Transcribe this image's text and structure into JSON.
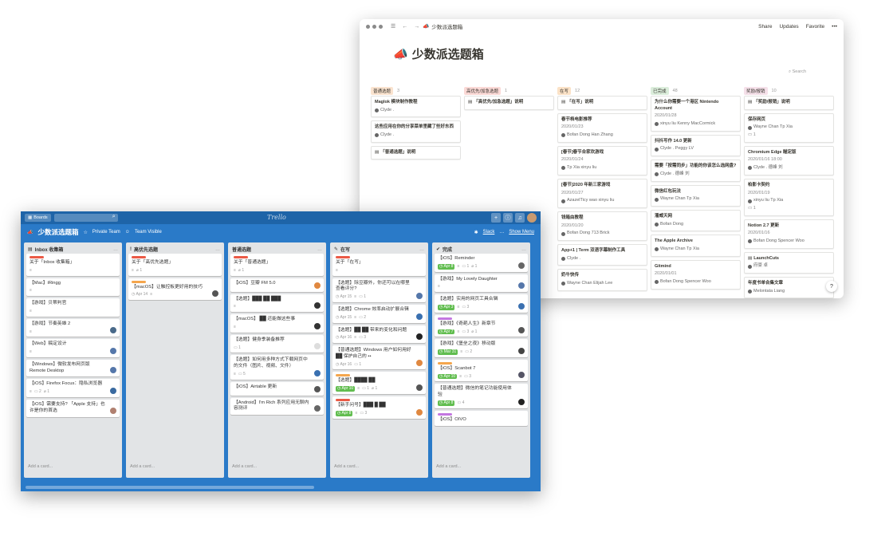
{
  "notion": {
    "breadcrumb": "少数派选题箱",
    "actions": [
      "Share",
      "Updates",
      "Favorite",
      "•••"
    ],
    "title": "少数派选题箱",
    "title_icon": "megaphone-icon",
    "search_label": "Search",
    "columns": [
      {
        "tag": "普通选题",
        "count": "3",
        "color": "#fae3cf",
        "cards": [
          {
            "title": "Maglok 模块制作教程",
            "people": "Clyde ."
          },
          {
            "title": "这些应用在你的分享菜单里藏了些好东西",
            "people": "Clyde ."
          },
          {
            "title": "「普通选题」说明",
            "doc": true
          }
        ]
      },
      {
        "tag": "高优先/加急选题",
        "count": "1",
        "color": "#fbd9d6",
        "cards": [
          {
            "title": "「高优先/加急选题」说明",
            "doc": true
          }
        ]
      },
      {
        "tag": "在写",
        "count": "12",
        "color": "#fbe2c7",
        "cards": [
          {
            "title": "「在写」说明",
            "doc": true
          },
          {
            "title": "春节档电影推荐",
            "date": "2020/01/23",
            "people": "Bofan Dong  Han Zhang"
          },
          {
            "title": "[春节]春节合家欢游戏",
            "date": "2020/01/24",
            "people": "Tp Xia  xinyu liu"
          },
          {
            "title": "[春节]2020 年新三家游戏",
            "date": "2020/01/27",
            "people": "AzazelTicy wao  xinyu liu"
          },
          {
            "title": "钱箱由教程",
            "date": "2020/01/20",
            "people": "Bofan Dong  713 Brick"
          },
          {
            "title": "App+1 | Term 双语字幕制作工具",
            "people": "Clyde ."
          },
          {
            "title": "奶牛快传",
            "people": "Wayne Chan  Elijah Lee"
          }
        ]
      },
      {
        "tag": "已完成",
        "count": "48",
        "color": "#dbeddb",
        "cards": [
          {
            "title": "为什么你需要一个港区 Nintendo Account",
            "date": "2020/01/28",
            "people": "xinyu liu  Kenny MacCormick"
          },
          {
            "title": "抖抖写作 14.0 更新",
            "people": "Clyde .  Peggy LV"
          },
          {
            "title": "需要「按需同步」功能的你该怎么选网盘?",
            "people": "Clyde .  德峰 刘"
          },
          {
            "title": "微信红包玩法",
            "people": "Wayne Chan  Tp Xia"
          },
          {
            "title": "潘威天网",
            "people": "Bofan Dong"
          },
          {
            "title": "The Apple Archive",
            "people": "Wayne Chan  Tp Xia"
          },
          {
            "title": "Gitmind",
            "date": "2020/01/01",
            "people": "Bofan Dong  Spencer Woo"
          }
        ]
      },
      {
        "tag": "奖励/报销",
        "count": "10",
        "color": "#f5e0e9",
        "cards": [
          {
            "title": "「奖励/报销」说明",
            "doc": true
          },
          {
            "title": "保存网页",
            "people": "Wayne Chan  Tp Xia",
            "comments": "1"
          },
          {
            "title": "Chromium Edge 瞄定版",
            "date": "2020/01/16 18:00",
            "people": "Clyde .  德峰 刘"
          },
          {
            "title": "柏影卡契约",
            "date": "2020/01/19",
            "people": "xinyu liu  Tp Xia",
            "comments": "1"
          },
          {
            "title": "Notion 2.7 更新",
            "date": "2020/01/16",
            "people": "Bofan Dong  Spencer Woo"
          },
          {
            "title": "LaunchCuts",
            "people": "府豪 卓",
            "doc": true
          },
          {
            "title": "年度书单合集文章",
            "people": "Melontata Liang"
          }
        ]
      }
    ],
    "help_label": "?"
  },
  "trello": {
    "boards_label": "Boards",
    "logo": "Trello",
    "board_name": "少数派选题箱",
    "team": "Private Team",
    "visibility": "Team Visible",
    "slack": "Slack",
    "show_menu": "Show Menu",
    "add_card": "Add a card...",
    "lists": [
      {
        "name": "Inbox 收集箱",
        "icon": "inbox-icon",
        "cards": [
          {
            "title": "关于「Inbox 收集箱」",
            "label": "#eb5a46",
            "desc": true
          },
          {
            "title": "【Mac】iRingg",
            "desc": true
          },
          {
            "title": "【游戏】贝蒂判官",
            "desc": true
          },
          {
            "title": "【游戏】节奏英雄 2",
            "desc": true,
            "avatar": "#4a6a8a"
          },
          {
            "title": "【Web】稿定设计",
            "desc": true,
            "avatar": "#5577aa"
          },
          {
            "title": "【Windows】微软发布网页版 Remote Desktop",
            "avatar": "#5577aa"
          },
          {
            "title": "【iOS】Firefox Focus：隐私浏览器",
            "desc": true,
            "comments": "2",
            "attach": "1",
            "avatar": "#3a6aa0"
          },
          {
            "title": "【iOS】需要支持? 「Apple 支持」也许是你的首选",
            "avatar": "#b08070"
          }
        ]
      },
      {
        "name": "高优先选题",
        "icon": "priority-icon",
        "cards": [
          {
            "title": "关于「高优先选题」",
            "label": "#eb5a46",
            "desc": true,
            "attach": "1"
          },
          {
            "title": "【macOS】让触控板更好用的技巧",
            "label": "#f5a64d",
            "date": "Apr 14",
            "desc": true,
            "avatar": "#555"
          }
        ]
      },
      {
        "name": "普通选题",
        "icon": "",
        "cards": [
          {
            "title": "关于「普通选题」",
            "label": "#eb5a46",
            "desc": true,
            "attach": "1"
          },
          {
            "title": "【iOS】豆瓣 FM 5.0",
            "avatar": "#e08840"
          },
          {
            "title": "【选题】███ ██ ███",
            "desc": true,
            "avatar": "#333"
          },
          {
            "title": "【macOS】 ██ 还能做这些事",
            "desc": true,
            "avatar": "#333"
          },
          {
            "title": "【选题】健身季装备推荐",
            "comments": "1",
            "avatar": "#ddd"
          },
          {
            "title": "【选题】如何用多种方式下载网页中的文件（图片、视频、文件）",
            "desc": true,
            "comments": "5",
            "avatar": "#3a70b0"
          },
          {
            "title": "【iOS】Airtable 更新",
            "avatar": "#555"
          },
          {
            "title": "【Android】I'm Rich 系列应用无聊内容测评",
            "avatar": "#666"
          }
        ]
      },
      {
        "name": "在写",
        "icon": "pencil-icon",
        "cards": [
          {
            "title": "关于「在写」",
            "label": "#eb5a46",
            "desc": true
          },
          {
            "title": "【选题】除豆瓣外，你还可以在哪里查看评分?",
            "date": "Apr 15",
            "desc": true,
            "comments": "1",
            "avatar": "#5577aa"
          },
          {
            "title": "【选题】Chrome 效率启动扩展合辑",
            "date": "Apr 15",
            "desc": true,
            "comments": "2",
            "avatar": "#3a70b0"
          },
          {
            "title": "【选题】██ ██ 带来的变化和问题",
            "date": "Apr 16",
            "desc": true,
            "comments": "3",
            "avatar": "#222"
          },
          {
            "title": "【普通选题】Windows 用户如何用好 ██ 保护自己的 ••",
            "date": "Apr 16",
            "comments": "1",
            "avatar": "#e08840"
          },
          {
            "title": "【选题】████ ██",
            "label": "#f5a64d",
            "date": "Apr 10",
            "due": true,
            "desc": true,
            "comments": "1",
            "attach": "1",
            "avatar": "#555"
          },
          {
            "title": "【新手问号】███ █ ██",
            "label": "#eb5a46",
            "date": "Apr 8",
            "due": true,
            "desc": true,
            "comments": "3",
            "avatar": "#e08840"
          }
        ]
      },
      {
        "name": "完成",
        "icon": "check-icon",
        "cards": [
          {
            "title": "【iOS】Reminder",
            "date": "Apr 8",
            "due": true,
            "desc": true,
            "comments": "1",
            "attach": "1",
            "avatar": "#666"
          },
          {
            "title": "【游戏】My Lovely Daughter",
            "desc": true,
            "avatar": "#5577aa"
          },
          {
            "title": "【选题】实用的网页工具合辑",
            "date": "Apr 3",
            "due": true,
            "desc": true,
            "comments": "3",
            "avatar": "#3a70b0"
          },
          {
            "title": "【游戏】《奇葩人生》新章节",
            "label": "#c377e0",
            "date": "Apr 7",
            "due": true,
            "desc": true,
            "comments": "3",
            "attach": "1",
            "avatar": "#555"
          },
          {
            "title": "【游戏】《堡垒之夜》移动版",
            "date": "Mar 31",
            "due": true,
            "desc": true,
            "comments": "2",
            "avatar": "#444"
          },
          {
            "title": "【iOS】Scanbot 7",
            "label": "#f5a64d",
            "date": "Apr 10",
            "due": true,
            "desc": true,
            "comments": "3",
            "avatar": "#556"
          },
          {
            "title": "【普通选题】微信的笔记功能使用体验",
            "date": "Apr 8",
            "due": true,
            "comments": "4",
            "avatar": "#222"
          },
          {
            "title": "【iOS】OIVO",
            "label": "#c377e0"
          }
        ]
      }
    ]
  }
}
